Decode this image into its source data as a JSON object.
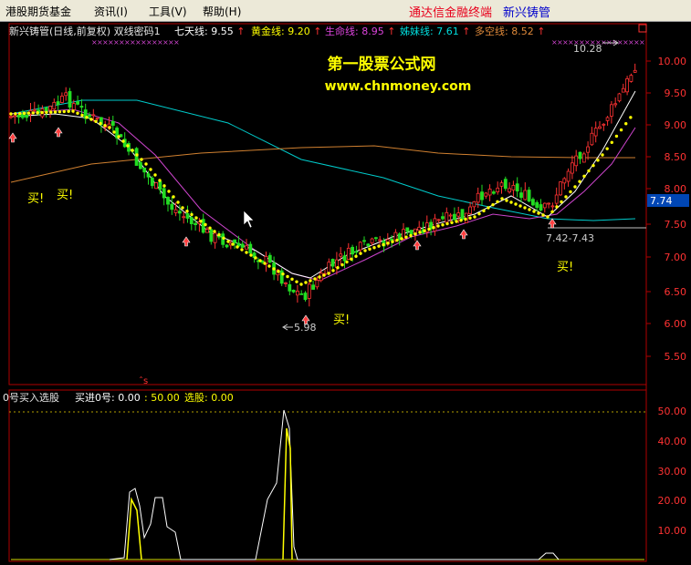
{
  "menubar": {
    "items": [
      {
        "label": "港股期货基金"
      },
      {
        "label": "资讯(I)"
      },
      {
        "label": "工具(V)"
      },
      {
        "label": "帮助(H)"
      }
    ],
    "link_tongda": "通达信金融终端",
    "link_xinxing": "新兴铸管",
    "accent_red": "#e8001c",
    "accent_blue": "#0000cc"
  },
  "main_header": {
    "title": "新兴铸管(日线,前复权) 双线密码1",
    "qitian_label": "七天线:",
    "qitian_value": "9.55",
    "huangjin_label": "黄金线:",
    "huangjin_value": "9.20",
    "shengming_label": "生命线:",
    "shengming_value": "8.95",
    "zimei_label": "姊妹线:",
    "zimei_value": "7.61",
    "duokong_label": "多空线:",
    "duokong_value": "8.52",
    "up_arrow": "↑"
  },
  "watermark": {
    "title": "第一股票公式网",
    "url": "www.chnmoney.com"
  },
  "annotations": {
    "high": "10.28",
    "low": "5.98",
    "range": "7.42-7.43",
    "buy": "买!"
  },
  "colors": {
    "up_candle": "#ff3232",
    "down_candle": "#22dd22",
    "qitian_line": "#ffffff",
    "huangjin_line": "#ffff00",
    "shengming_line": "#cc44cc",
    "zimei_line": "#00cccc",
    "duokong_line": "#d08030"
  },
  "price_axis": {
    "ticks": [
      "10.00",
      "9.50",
      "9.00",
      "8.50",
      "8.00",
      "7.50",
      "7.00",
      "6.50",
      "6.00",
      "5.50"
    ],
    "current_price": "7.74"
  },
  "sub_header": {
    "title": "0号买入选股",
    "buy0_label": "买进0号:",
    "buy0_value": "0.00",
    "ref_value": ": 50.00",
    "pick_label": "选股:",
    "pick_value": "0.00"
  },
  "sub_axis": {
    "ticks": [
      "50.00",
      "40.00",
      "30.00",
      "20.00",
      "10.00"
    ]
  },
  "chart_data": {
    "type": "candlestick",
    "y_range": [
      5.2,
      10.6
    ],
    "high": 10.28,
    "low": 5.98,
    "current": 7.74,
    "ma": {
      "qitian": 9.55,
      "huangjin": 9.2,
      "shengming": 8.95,
      "zimei": 7.61,
      "duokong": 8.52
    },
    "indicator": {
      "name": "0号买入选股",
      "y_range": [
        0,
        55
      ],
      "reference": 50
    }
  }
}
